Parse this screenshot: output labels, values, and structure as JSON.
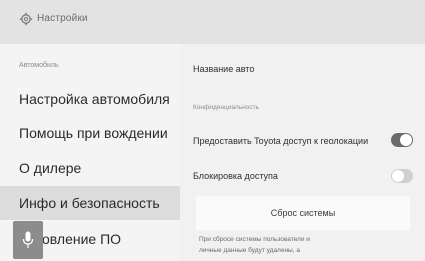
{
  "header": {
    "title": "Настройки",
    "icon": "gear-icon"
  },
  "sidebar": {
    "section_label": "Автомобиль",
    "items": [
      {
        "label": "Настройка автомобиля",
        "chevron": "›"
      },
      {
        "label": "Помощь при вождении"
      },
      {
        "label": "О дилере"
      },
      {
        "label": "Инфо и безопасность"
      },
      {
        "label": "овление ПО"
      }
    ],
    "active_index": 3,
    "mic_icon": "microphone-icon"
  },
  "main": {
    "car_name_label": "Название авто",
    "privacy_section": "Конфиденциальность",
    "location_toggle": {
      "label": "Предоставить Toyota доступ к геолокации",
      "on": true
    },
    "lock_toggle": {
      "label": "Блокировка доступа",
      "on": false
    },
    "reset_button": "Сброс системы",
    "reset_note": [
      "При сбросе системы пользователи и",
      "личные данные будут удалены, а"
    ]
  },
  "colors": {
    "accent": "#6b6b6b",
    "background": "#f1f1f1",
    "active_item": "#dcdcdc"
  }
}
